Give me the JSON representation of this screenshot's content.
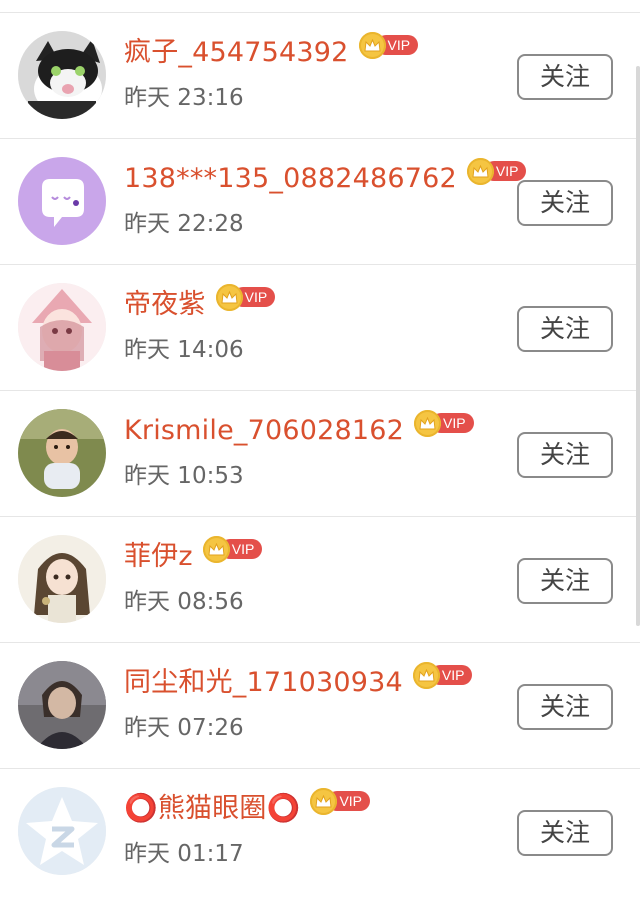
{
  "follow_label": "关注",
  "vip_label": "VIP",
  "colors": {
    "name": "#d9502e",
    "time": "#666666",
    "vip_pill": "#e44f4a",
    "crown": "#f5c542"
  },
  "users": [
    {
      "name": "疯子_454754392",
      "time": "昨天 23:16",
      "avatar_icon": "cat-photo-avatar"
    },
    {
      "name": "138***135_0882486762",
      "time": "昨天 22:28",
      "avatar_icon": "chat-bubble-avatar"
    },
    {
      "name": "帝夜紫",
      "time": "昨天 14:06",
      "avatar_icon": "anime-girl-avatar"
    },
    {
      "name": "Krismile_706028162",
      "time": "昨天 10:53",
      "avatar_icon": "baby-photo-avatar"
    },
    {
      "name": "菲伊z",
      "time": "昨天 08:56",
      "avatar_icon": "anime-girl-avatar"
    },
    {
      "name": "同尘和光_171030934",
      "time": "昨天 07:26",
      "avatar_icon": "portrait-photo-avatar"
    },
    {
      "name": "⭕熊猫眼圈⭕",
      "time": "昨天 01:17",
      "avatar_icon": "qzone-star-avatar"
    }
  ]
}
